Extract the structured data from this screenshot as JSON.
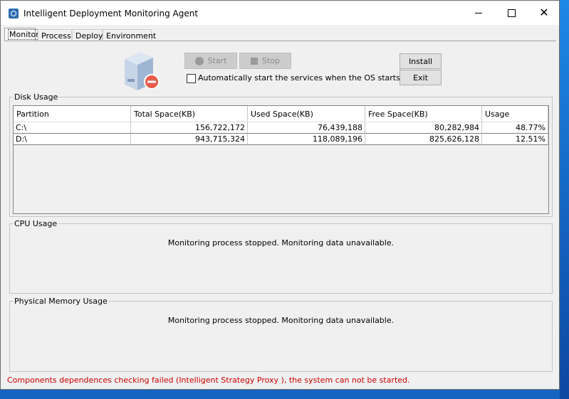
{
  "window": {
    "title": "Intelligent Deployment Monitoring Agent"
  },
  "tabs": [
    {
      "label": "Monitor",
      "active": true
    },
    {
      "label": "Process",
      "active": false
    },
    {
      "label": "Deploy",
      "active": false
    },
    {
      "label": "Environment",
      "active": false
    }
  ],
  "controls": {
    "start_label": "Start",
    "stop_label": "Stop",
    "install_label": "Install",
    "exit_label": "Exit",
    "autostart_label": "Automatically start the services when the OS starts.",
    "autostart_checked": false
  },
  "disk_usage": {
    "title": "Disk Usage",
    "columns": [
      "Partition",
      "Total Space(KB)",
      "Used Space(KB)",
      "Free Space(KB)",
      "Usage"
    ],
    "rows": [
      [
        "C:\\",
        "156,722,172",
        "76,439,188",
        "80,282,984",
        "48.77%"
      ],
      [
        "D:\\",
        "943,715,324",
        "118,089,196",
        "825,626,128",
        "12.51%"
      ]
    ]
  },
  "cpu_usage": {
    "title": "CPU Usage",
    "message": "Monitoring process stopped. Monitoring data unavailable."
  },
  "memory_usage": {
    "title": "Physical Memory Usage",
    "message": "Monitoring process stopped. Monitoring data unavailable."
  },
  "status": {
    "message": "Components dependences checking failed (Intelligent Strategy Proxy ), the system can not be started.",
    "color": "#cc0000"
  },
  "icons": {
    "app": "app-icon",
    "server": "server-stopped-icon"
  }
}
